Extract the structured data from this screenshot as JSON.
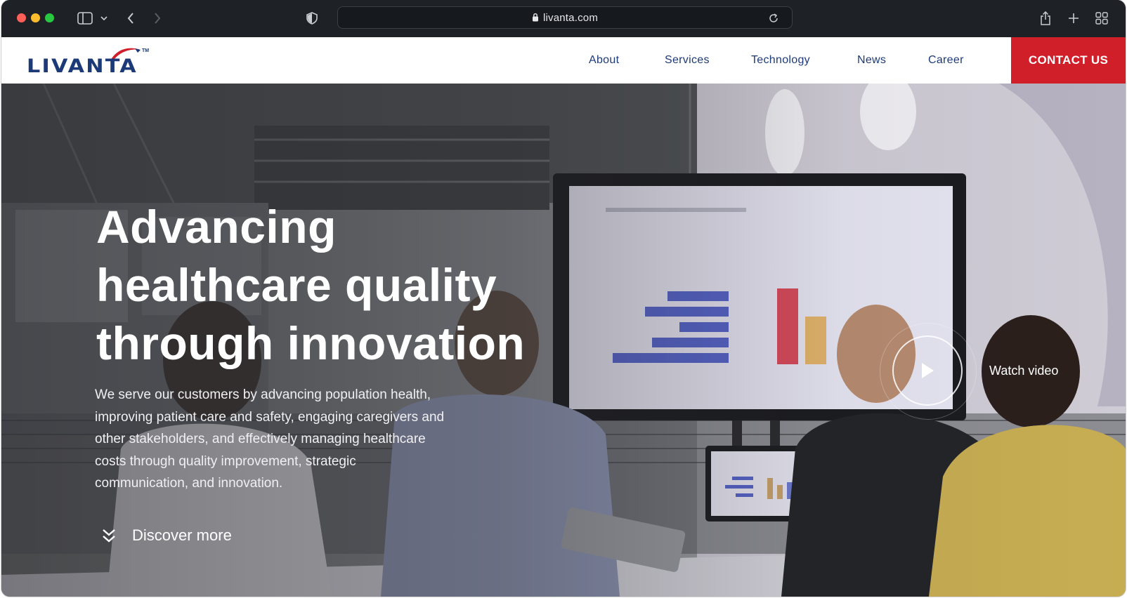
{
  "browser": {
    "url": "livanta.com"
  },
  "site": {
    "logo_text": "LIVANTA",
    "logo_tm": "TM",
    "nav": [
      {
        "label": "About"
      },
      {
        "label": "Services"
      },
      {
        "label": "Technology"
      },
      {
        "label": "News"
      },
      {
        "label": "Career"
      }
    ],
    "contact_label": "CONTACT US",
    "brand_colors": {
      "primary": "#1d3a78",
      "accent": "#d11f2a"
    }
  },
  "hero": {
    "title_lines": [
      "Advancing",
      "healthcare quality",
      "through innovation"
    ],
    "body_lines": [
      "We serve our customers by advancing population health,",
      "improving patient care and safety, engaging caregivers and",
      "other stakeholders, and effectively managing healthcare",
      "costs through quality improvement, strategic",
      "communication, and innovation."
    ],
    "discover_label": "Discover more",
    "watch_label": "Watch video"
  },
  "icons": [
    "sidebar-icon",
    "chevron-down-icon",
    "back-icon",
    "forward-icon",
    "shield-icon",
    "lock-icon",
    "reload-icon",
    "share-icon",
    "new-tab-icon",
    "tab-overview-icon",
    "play-icon",
    "double-chevron-down-icon"
  ]
}
